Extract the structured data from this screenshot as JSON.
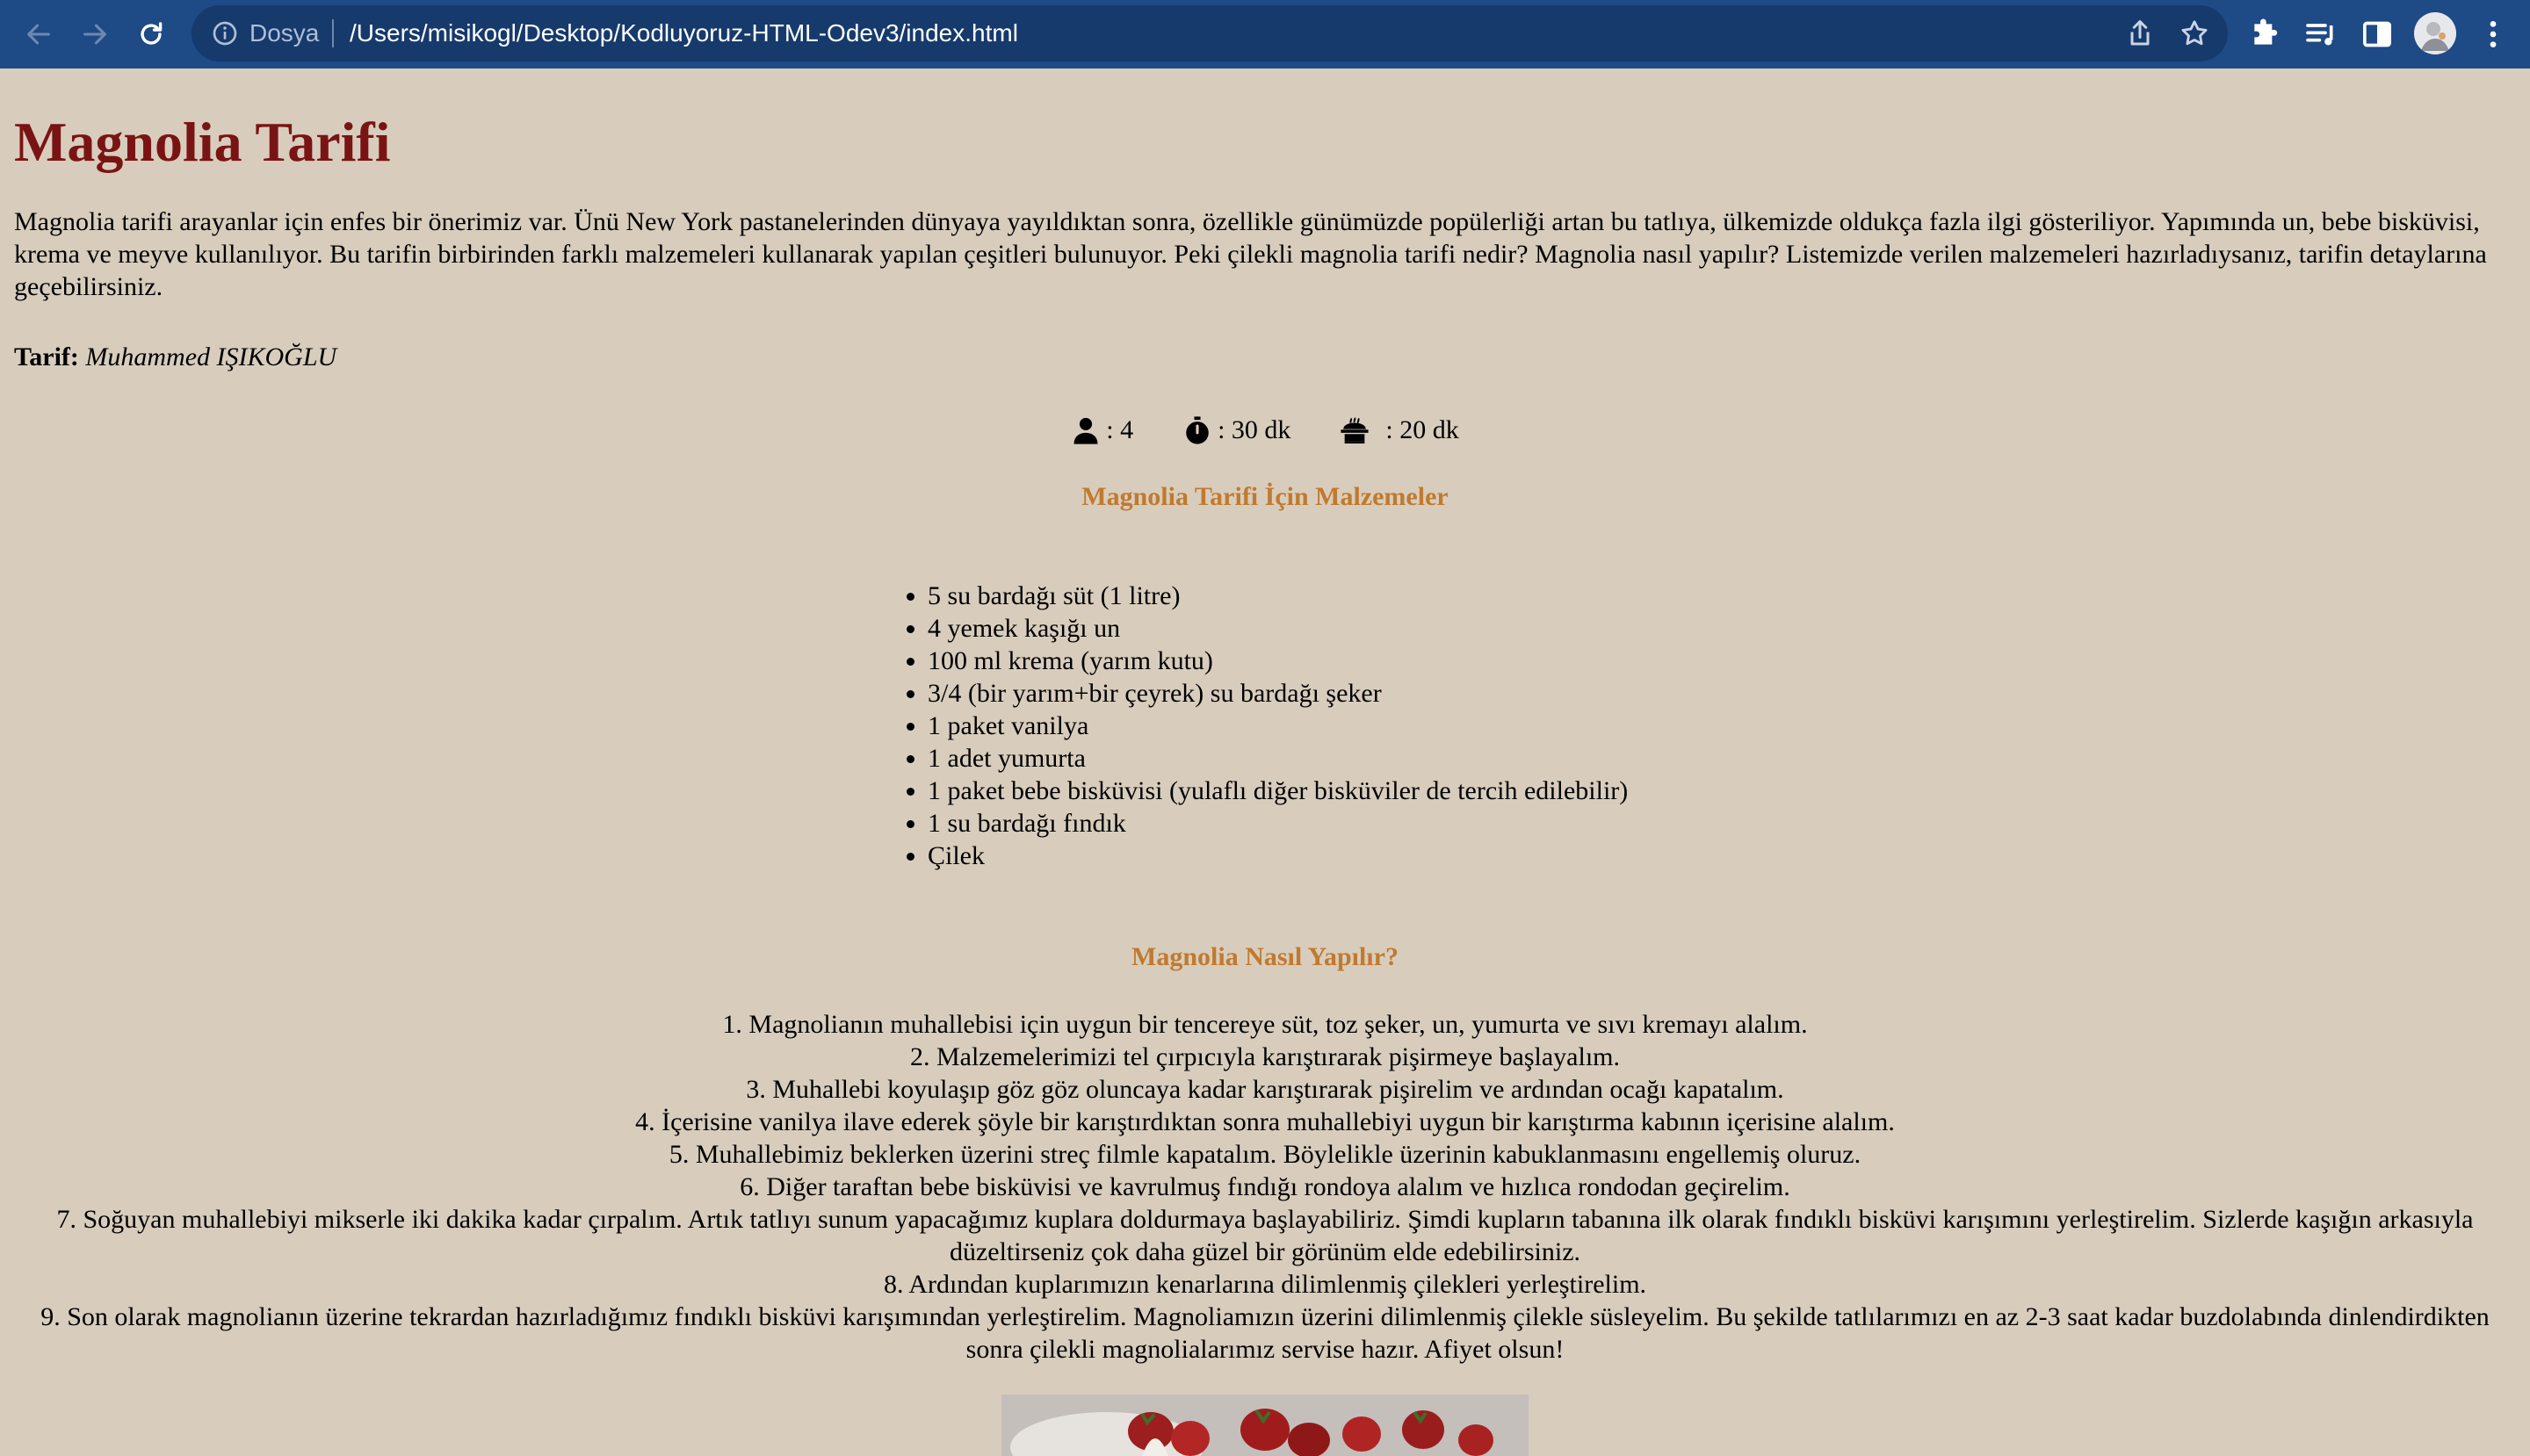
{
  "browser": {
    "scheme_label": "Dosya",
    "url": "/Users/misikogl/Desktop/Kodluyoruz-HTML-Odev3/index.html",
    "icons": [
      "back-arrow-icon",
      "forward-arrow-icon",
      "reload-icon",
      "info-icon",
      "share-icon",
      "bookmark-star-icon",
      "extensions-puzzle-icon",
      "media-queue-icon",
      "side-panel-icon",
      "profile-avatar",
      "more-menu-icon"
    ],
    "colors": {
      "toolbar": "#1e4a86",
      "omnibox": "#163a6c"
    }
  },
  "page": {
    "title": "Magnolia Tarifi",
    "intro": "Magnolia tarifi arayanlar için enfes bir önerimiz var. Ünü New York pastanelerinden dünyaya yayıldıktan sonra, özellikle günümüzde popülerliği artan bu tatlıya, ülkemizde oldukça fazla ilgi gösteriliyor. Yapımında un, bebe bisküvisi, krema ve meyve kullanılıyor. Bu tarifin birbirinden farklı malzemeleri kullanarak yapılan çeşitleri bulunuyor. Peki çilekli magnolia tarifi nedir? Magnolia nasıl yapılır? Listemizde verilen malzemeleri hazırladıysanız, tarifin detaylarına geçebilirsiniz.",
    "author_label": "Tarif:",
    "author_name": "Muhammed IŞIKOĞLU",
    "meta": {
      "servings": ": 4",
      "prep_time": ": 30 dk",
      "cook_time": ": 20 dk",
      "icons": [
        "person-icon",
        "stopwatch-icon",
        "cooking-pot-icon"
      ]
    },
    "ingredients_title": "Magnolia Tarifi İçin Malzemeler",
    "ingredients": [
      "5 su bardağı süt (1 litre)",
      "4 yemek kaşığı un",
      "100 ml krema (yarım kutu)",
      "3/4 (bir yarım+bir çeyrek) su bardağı şeker",
      "1 paket vanilya",
      "1 adet yumurta",
      "1 paket bebe bisküvisi (yulaflı diğer bisküviler de tercih edilebilir)",
      "1 su bardağı fındık",
      "Çilek"
    ],
    "steps_title": "Magnolia Nasıl Yapılır?",
    "steps": [
      "1. Magnolianın muhallebisi için uygun bir tencereye süt, toz şeker, un, yumurta ve sıvı kremayı alalım.",
      "2. Malzemelerimizi tel çırpıcıyla karıştırarak pişirmeye başlayalım.",
      "3. Muhallebi koyulaşıp göz göz oluncaya kadar karıştırarak pişirelim ve ardından ocağı kapatalım.",
      "4. İçerisine vanilya ilave ederek şöyle bir karıştırdıktan sonra muhallebiyi uygun bir karıştırma kabının içerisine alalım.",
      "5. Muhallebimiz beklerken üzerini streç filmle kapatalım. Böylelikle üzerinin kabuklanmasını engellemiş oluruz.",
      "6. Diğer taraftan bebe bisküvisi ve kavrulmuş fındığı rondoya alalım ve hızlıca rondodan geçirelim.",
      "7. Soğuyan muhallebiyi mikserle iki dakika kadar çırpalım. Artık tatlıyı sunum yapacağımız kuplara doldurmaya başlayabiliriz. Şimdi kupların tabanına ilk olarak fındıklı bisküvi karışımını yerleştirelim. Sizlerde kaşığın arkasıyla düzeltirseniz çok daha güzel bir görünüm elde edebilirsiniz.",
      "8. Ardından kuplarımızın kenarlarına dilimlenmiş çilekleri yerleştirelim.",
      "9. Son olarak magnolianın üzerine tekrardan hazırladığımız fındıklı bisküvi karışımından yerleştirelim. Magnoliamızın üzerini dilimlenmiş çilekle süsleyelim. Bu şekilde tatlılarımızı en az 2-3 saat kadar buzdolabında dinlendirdikten sonra çilekli magnolialarımız servise hazır. Afiyet olsun!"
    ],
    "colors": {
      "background": "#d8cdbd",
      "title": "#7a1414",
      "section_heading": "#c07a2e"
    }
  }
}
